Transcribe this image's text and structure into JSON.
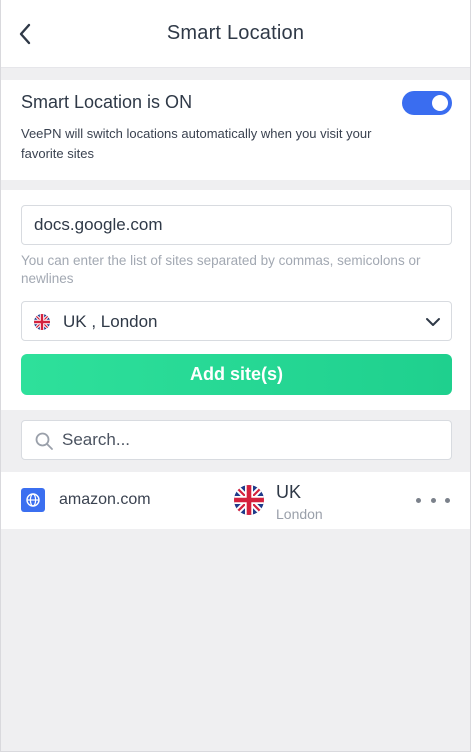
{
  "header": {
    "title": "Smart Location"
  },
  "smart_location": {
    "title": "Smart Location is ON",
    "description": "VeePN will switch locations automatically when you visit your favorite sites",
    "enabled": true,
    "accent_color": "#3a6df0"
  },
  "form": {
    "site_value": "docs.google.com",
    "hint": "You can enter the list of sites separated by commas, semicolons or newlines",
    "location_label": "UK , London",
    "add_button_label": "Add site(s)",
    "button_color": "#2ee09b"
  },
  "search": {
    "placeholder": "Search..."
  },
  "sites": [
    {
      "domain": "amazon.com",
      "country": "UK",
      "city": "London",
      "icon": "globe-icon",
      "flag": "uk-flag-icon"
    }
  ]
}
